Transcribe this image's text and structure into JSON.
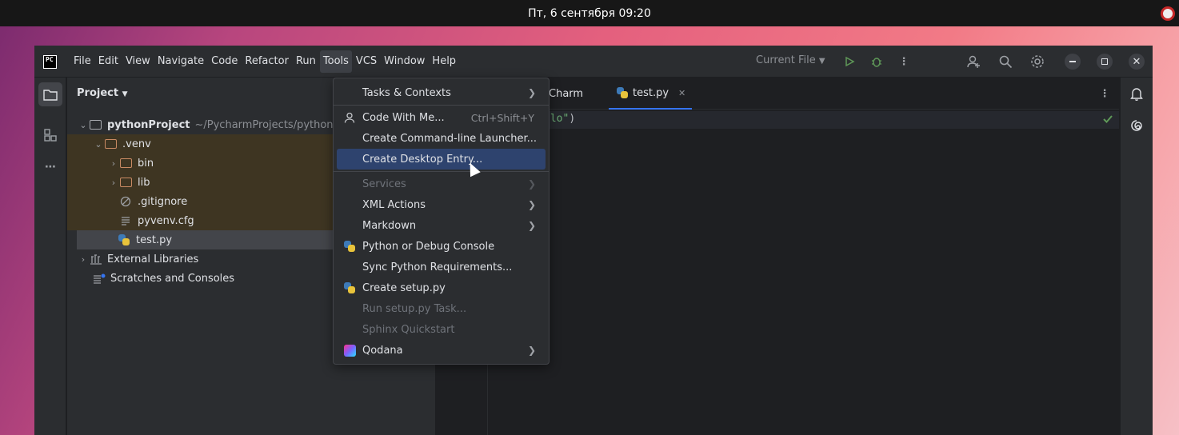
{
  "system": {
    "clock": "Пт, 6 сентября  09:20"
  },
  "menubar": {
    "logo": "PC",
    "items": [
      "File",
      "Edit",
      "View",
      "Navigate",
      "Code",
      "Refactor",
      "Run",
      "Tools",
      "VCS",
      "Window",
      "Help"
    ],
    "active": "Tools",
    "run_config": "Current File"
  },
  "project": {
    "title": "Project",
    "tree": [
      {
        "label": "pythonProject",
        "path": "~/PycharmProjects/pythonPro",
        "arrow": "expanded"
      },
      {
        "label": ".venv",
        "arrow": "expanded"
      },
      {
        "label": "bin",
        "arrow": "collapsed"
      },
      {
        "label": "lib",
        "arrow": "collapsed"
      },
      {
        "label": ".gitignore"
      },
      {
        "label": "pyvenv.cfg"
      },
      {
        "label": "test.py"
      },
      {
        "label": "External Libraries",
        "arrow": "collapsed"
      },
      {
        "label": "Scratches and Consoles"
      }
    ]
  },
  "editor": {
    "tabs": [
      {
        "label": "Charm"
      },
      {
        "label": "test.py",
        "active": true
      }
    ],
    "code_fragment": "llo\"",
    "code_paren": ")"
  },
  "tools_menu": {
    "items": [
      {
        "label": "Tasks & Contexts",
        "submenu": true
      },
      {
        "label": "Code With Me...",
        "shortcut": "Ctrl+Shift+Y",
        "icon": "person-icon"
      },
      {
        "label": "Create Command-line Launcher..."
      },
      {
        "label": "Create Desktop Entry...",
        "highlighted": true
      },
      {
        "label": "Services",
        "submenu": true,
        "disabled": true
      },
      {
        "label": "XML Actions",
        "submenu": true
      },
      {
        "label": "Markdown",
        "submenu": true
      },
      {
        "label": "Python or Debug Console",
        "icon": "python-icon"
      },
      {
        "label": "Sync Python Requirements..."
      },
      {
        "label": "Create setup.py",
        "icon": "python-icon"
      },
      {
        "label": "Run setup.py Task...",
        "disabled": true
      },
      {
        "label": "Sphinx Quickstart",
        "disabled": true
      },
      {
        "label": "Qodana",
        "submenu": true,
        "icon": "qodana-icon"
      }
    ]
  },
  "colors": {
    "accent": "#3574f0",
    "highlight": "#2e436e",
    "excluded": "#3e3522"
  }
}
